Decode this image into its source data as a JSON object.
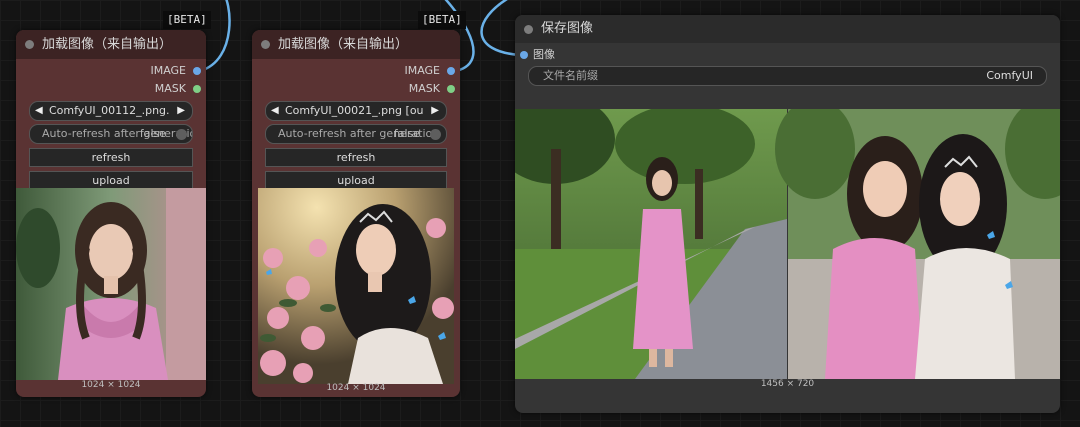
{
  "badges": {
    "beta": "[BETA]"
  },
  "load_nodes": [
    {
      "title": "加载图像（来自输出）",
      "outputs": [
        "IMAGE",
        "MASK"
      ],
      "image_file": "ComfyUI_00112_.png...",
      "auto_refresh_label": "Auto-refresh after generation",
      "auto_refresh_value": "false",
      "refresh_label": "refresh",
      "upload_label": "upload",
      "dimensions": "1024 × 1024"
    },
    {
      "title": "加载图像（来自输出）",
      "outputs": [
        "IMAGE",
        "MASK"
      ],
      "image_file": "ComfyUI_00021_.png [ou...",
      "auto_refresh_label": "Auto-refresh after generation",
      "auto_refresh_value": "false",
      "refresh_label": "refresh",
      "upload_label": "upload",
      "dimensions": "1024 × 1024"
    }
  ],
  "save_node": {
    "title": "保存图像",
    "input": "图像",
    "filename_prefix_label": "文件名前缀",
    "filename_prefix_value": "ComfyUI",
    "dimensions": "1456 × 720"
  },
  "colors": {
    "image_socket": "#6aa8e8",
    "mask_socket": "#7fcf86",
    "wire": "#6ab1e8",
    "load_node_body": "#5a3333",
    "load_node_title": "#3c2323",
    "save_node_body": "#353535"
  }
}
